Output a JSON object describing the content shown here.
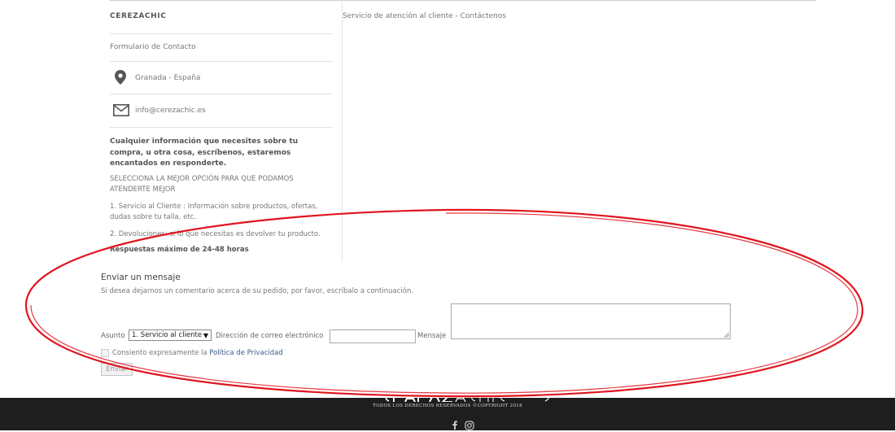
{
  "contact_panel": {
    "brand": "CEREZACHIC",
    "form_link": "Formulario de Contacto",
    "location": "Granada - España",
    "email": "info@cerezachic.es",
    "intro": "Cualquier información que necesites sobre tu compra, u otra cosa, escríbenos, estaremos encantados en responderte.",
    "select_best": "SELECCIONA LA MEJOR OPCIÓN PARA QUE PODAMOS ATENDERTE MEJOR",
    "option_1": "1. Servicio al Cliente : Información sobre productos, ofertas, dudas sobre tu talla, etc.",
    "option_2": "2. Devoluciones: si lo que necesitas es devolver tu producto.",
    "responses": "Respuestas  máximo de 24-48 horas"
  },
  "header_right": "Servicio de atención al cliente - Contáctenos",
  "message_form": {
    "title": "Enviar un mensaje",
    "description": "Si desea dejarnos un comentario acerca de su pedido, por favor, escríbalo a continuación.",
    "subject_label": "Asunto",
    "subject_selected": "1. Servicio al cliente",
    "email_label": "Dirección de correo electrónico",
    "email_value": "",
    "message_label": "Mensaje",
    "message_value": "",
    "consent_text": "Consiento expresamente la",
    "privacy_link": "Política de Privacidad",
    "consent_checked": false,
    "send_label": "Enviar"
  },
  "footer": {
    "copyright": "TODOS LOS DERECHOS RESERVADOS ©COPYRIGHT 2018",
    "social_icons": [
      "facebook-icon",
      "instagram-icon"
    ],
    "background_color": "#1e1e1e"
  },
  "annotation": {
    "shape": "ellipse",
    "color": "#e0141e"
  }
}
